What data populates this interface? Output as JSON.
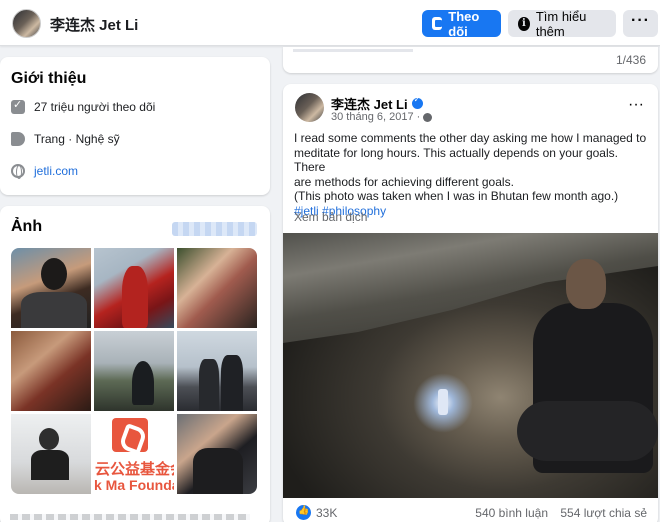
{
  "header": {
    "page_name": "李连杰 Jet Li",
    "follow_label": "Theo dõi",
    "info_label": "Tìm hiểu thêm",
    "more_label": "···",
    "accent": "#1877f2"
  },
  "intro": {
    "title": "Giới thiệu",
    "followers": "27 triệu người theo dõi",
    "category": "Trang · Nghệ sỹ",
    "website": "jetli.com"
  },
  "photos": {
    "title": "Ảnh",
    "foundation_text_cn": "云公益基金会",
    "foundation_text_en": "k Ma Foundati"
  },
  "feed": {
    "counter": "1/436",
    "post": {
      "author": "李连杰 Jet Li",
      "date": "30 tháng 6, 2017 ·",
      "text_lines": [
        "I read some comments the other day asking me how I managed to",
        "meditate for long hours. This actually depends on your goals. There",
        "are methods for achieving different goals.",
        "(This photo was taken when I was in Bhutan few month ago.)"
      ],
      "hashtags": "#jetli #philosophy",
      "translate": "Xem bản dịch",
      "likes": "33K",
      "comments": "540 bình luận",
      "shares": "554 lượt chia sẻ",
      "more_label": "···"
    }
  }
}
